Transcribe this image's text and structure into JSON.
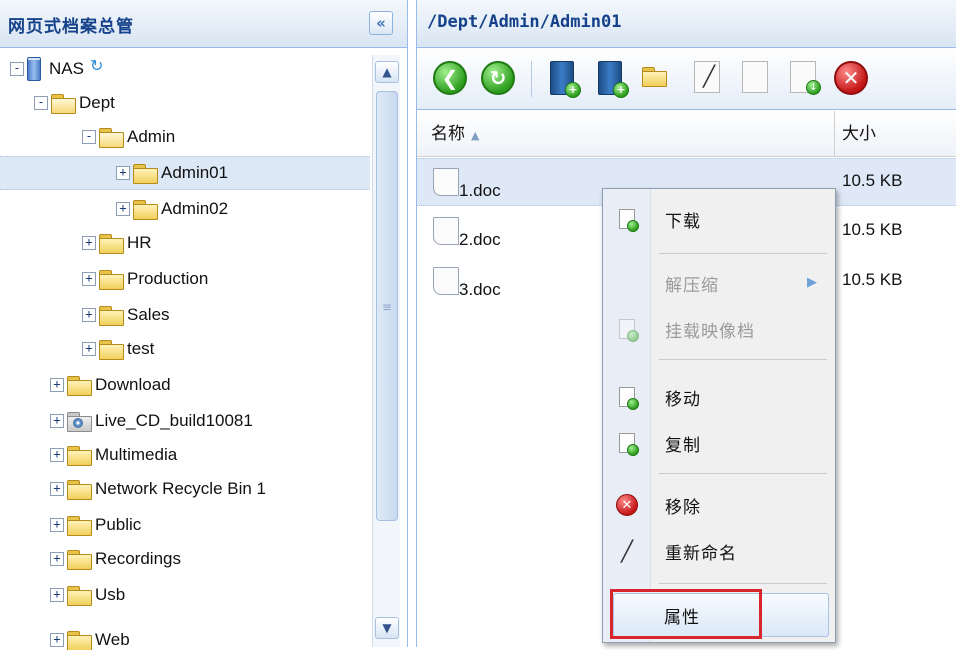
{
  "left_panel": {
    "title": "网页式档案总管",
    "collapse_icon": "«",
    "tree": [
      {
        "label": "NAS",
        "expander": "-",
        "icon": "nas-icon",
        "selected": false
      },
      {
        "label": "Dept",
        "expander": "-",
        "icon": "folder-open-icon",
        "selected": false
      },
      {
        "label": "Admin",
        "expander": "-",
        "icon": "folder-open-icon",
        "selected": false
      },
      {
        "label": "Admin01",
        "expander": "+",
        "icon": "folder-icon",
        "selected": true
      },
      {
        "label": "Admin02",
        "expander": "+",
        "icon": "folder-icon",
        "selected": false
      },
      {
        "label": "HR",
        "expander": "+",
        "icon": "folder-icon",
        "selected": false
      },
      {
        "label": "Production",
        "expander": "+",
        "icon": "folder-icon",
        "selected": false
      },
      {
        "label": "Sales",
        "expander": "+",
        "icon": "folder-icon",
        "selected": false
      },
      {
        "label": "test",
        "expander": "+",
        "icon": "folder-icon",
        "selected": false
      },
      {
        "label": "Download",
        "expander": "+",
        "icon": "folder-icon",
        "selected": false
      },
      {
        "label": "Live_CD_build10081",
        "expander": "+",
        "icon": "disc-folder-icon",
        "selected": false
      },
      {
        "label": "Multimedia",
        "expander": "+",
        "icon": "folder-icon",
        "selected": false
      },
      {
        "label": "Network Recycle Bin 1",
        "expander": "+",
        "icon": "folder-icon",
        "selected": false
      },
      {
        "label": "Public",
        "expander": "+",
        "icon": "folder-icon",
        "selected": false
      },
      {
        "label": "Recordings",
        "expander": "+",
        "icon": "folder-icon",
        "selected": false
      },
      {
        "label": "Usb",
        "expander": "+",
        "icon": "folder-icon",
        "selected": false
      },
      {
        "label": "Web",
        "expander": "+",
        "icon": "folder-icon",
        "selected": false
      }
    ],
    "scrollbar": {
      "up": "▲",
      "down": "▼",
      "grip": "≡"
    }
  },
  "right_panel": {
    "path": "/Dept/Admin/Admin01",
    "toolbar_icons": [
      "back-icon",
      "refresh-icon",
      "create-share-icon",
      "create-folder-icon",
      "upload-folder-icon",
      "rename-icon",
      "copy-icon",
      "move-icon",
      "delete-icon"
    ],
    "columns": {
      "name": "名称",
      "size": "大小"
    },
    "files": [
      {
        "name": "1.doc",
        "size": "10.5 KB",
        "selected": true
      },
      {
        "name": "2.doc",
        "size": "10.5 KB",
        "selected": false
      },
      {
        "name": "3.doc",
        "size": "10.5 KB",
        "selected": false
      }
    ]
  },
  "context_menu": {
    "download": "下载",
    "extract": "解压缩",
    "mount_iso": "挂载映像档",
    "move": "移动",
    "copy": "复制",
    "delete": "移除",
    "rename": "重新命名",
    "properties": "属性"
  },
  "colors": {
    "header_text": "#15428b",
    "highlight_box": "#d8262c",
    "selection": "#dde8f6"
  }
}
